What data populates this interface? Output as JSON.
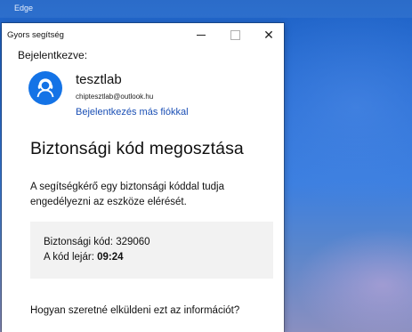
{
  "taskbar": {
    "app_title": "Edge"
  },
  "window": {
    "title": "Gyors segítség",
    "controls": {
      "minimize": "minimize",
      "maximize": "maximize",
      "close": "close"
    }
  },
  "account": {
    "signed_in_label": "Bejelentkezve:",
    "name": "tesztlab",
    "email": "chiptesztlab@outlook.hu",
    "other_account_link": "Bejelentkezés más fiókkal",
    "avatar_icon": "user-headset-icon",
    "avatar_color": "#1473e6"
  },
  "main": {
    "heading": "Biztonsági kód megosztása",
    "description": "A segítségkérő egy biztonsági kóddal tudja engedélyezni az eszköze elérését.",
    "code_label": "Biztonsági kód:",
    "code_value": "329060",
    "expiry_label": "A kód lejár:",
    "expiry_value": "09:24",
    "question": "Hogyan szeretné elküldeni ezt az információt?"
  },
  "colors": {
    "link": "#1a4fb5",
    "code_box_bg": "#f2f2f2",
    "desktop_blue": "#2a6fd6"
  }
}
